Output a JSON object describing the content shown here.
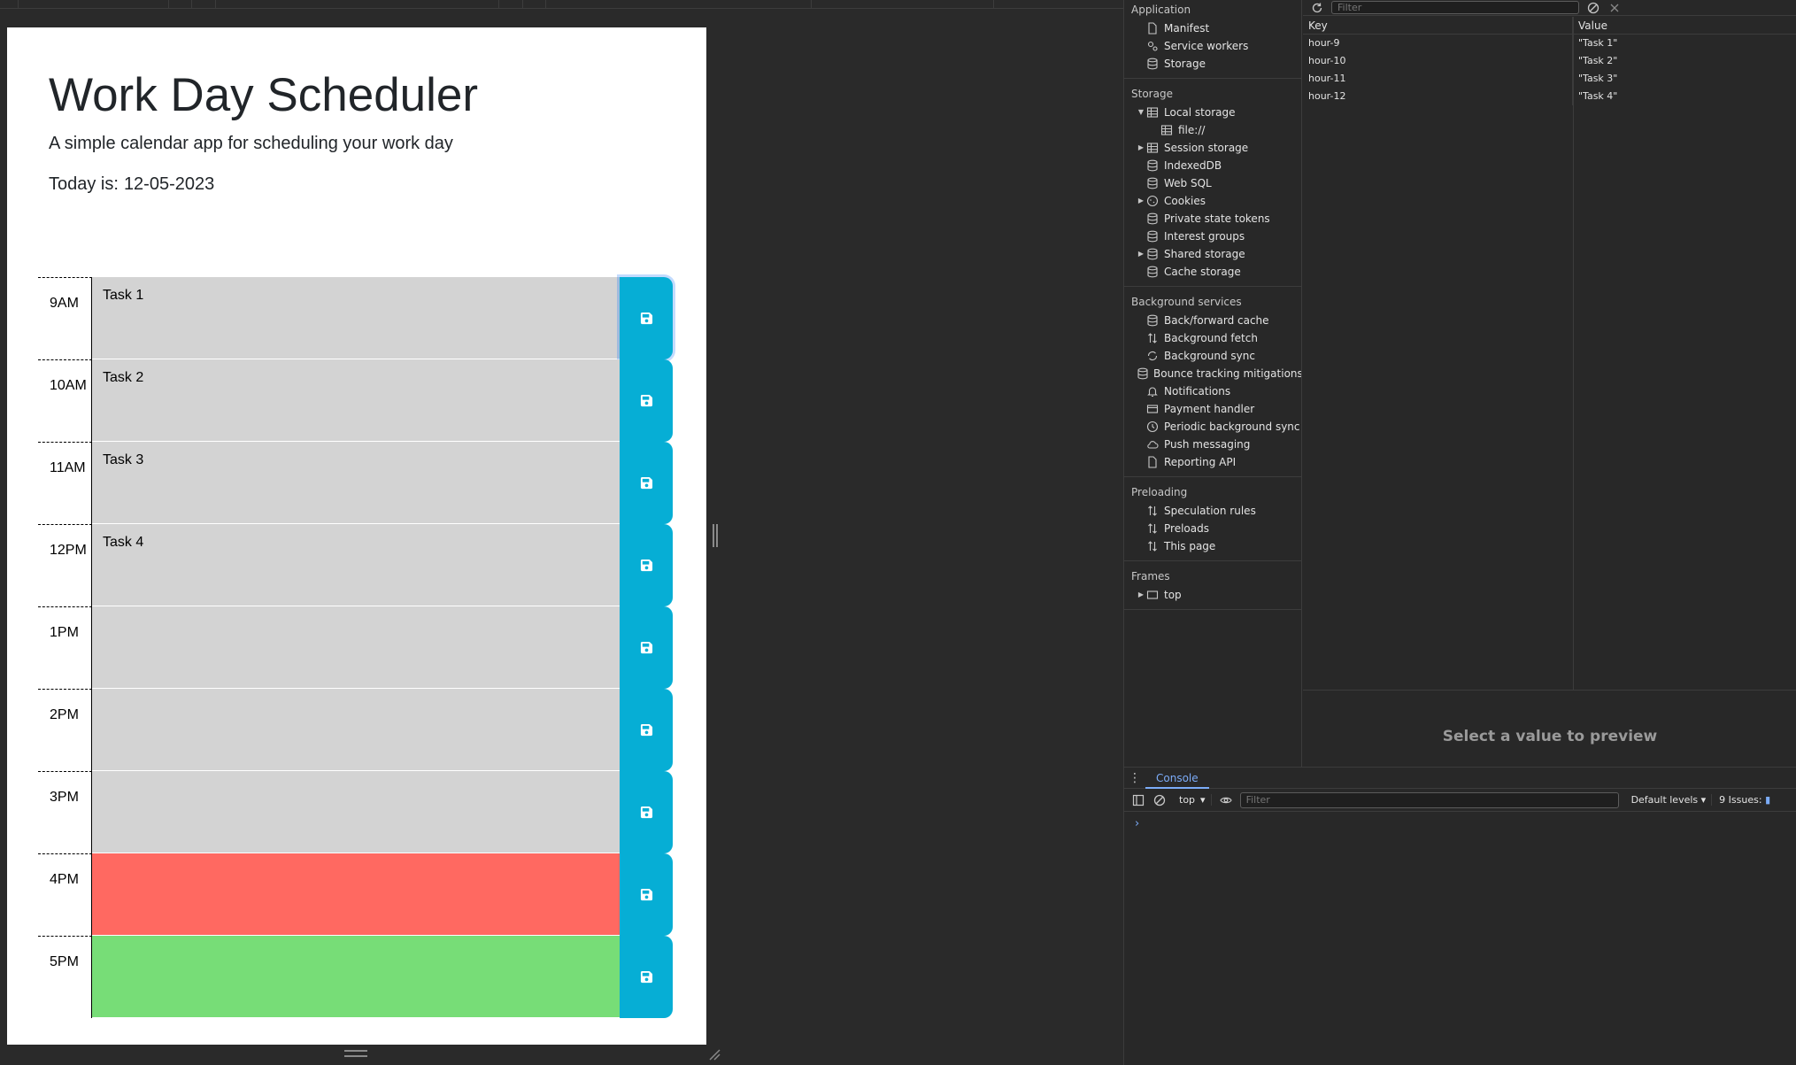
{
  "app": {
    "title": "Work Day Scheduler",
    "lead": "A simple calendar app for scheduling your work day",
    "today_label": "Today is:",
    "today_value": "12-05-2023"
  },
  "schedule": [
    {
      "hour": "9AM",
      "task": "Task 1",
      "state": "past"
    },
    {
      "hour": "10AM",
      "task": "Task 2",
      "state": "past"
    },
    {
      "hour": "11AM",
      "task": "Task 3",
      "state": "past"
    },
    {
      "hour": "12PM",
      "task": "Task 4",
      "state": "past"
    },
    {
      "hour": "1PM",
      "task": "",
      "state": "past"
    },
    {
      "hour": "2PM",
      "task": "",
      "state": "past"
    },
    {
      "hour": "3PM",
      "task": "",
      "state": "past"
    },
    {
      "hour": "4PM",
      "task": "",
      "state": "present"
    },
    {
      "hour": "5PM",
      "task": "",
      "state": "future"
    }
  ],
  "colors": {
    "past": "#d3d3d3",
    "present": "#ff6961",
    "future": "#77dd77",
    "save_button": "#06aed5",
    "devtools_bg": "#282828",
    "devtools_accent": "#7cacf8"
  },
  "devtools": {
    "sidebar": {
      "application": {
        "title": "Application",
        "items": [
          {
            "label": "Manifest",
            "icon": "file-icon"
          },
          {
            "label": "Service workers",
            "icon": "gears-icon"
          },
          {
            "label": "Storage",
            "icon": "database-icon"
          }
        ]
      },
      "storage": {
        "title": "Storage",
        "items": [
          {
            "label": "Local storage",
            "icon": "table-icon",
            "expanded": true
          },
          {
            "label": "file://",
            "icon": "table-icon",
            "child": true
          },
          {
            "label": "Session storage",
            "icon": "table-icon",
            "collapsed": true
          },
          {
            "label": "IndexedDB",
            "icon": "database-icon"
          },
          {
            "label": "Web SQL",
            "icon": "database-icon"
          },
          {
            "label": "Cookies",
            "icon": "cookie-icon",
            "collapsed": true
          },
          {
            "label": "Private state tokens",
            "icon": "database-icon"
          },
          {
            "label": "Interest groups",
            "icon": "database-icon"
          },
          {
            "label": "Shared storage",
            "icon": "database-icon",
            "collapsed": true
          },
          {
            "label": "Cache storage",
            "icon": "database-icon"
          }
        ]
      },
      "background": {
        "title": "Background services",
        "items": [
          {
            "label": "Back/forward cache",
            "icon": "database-icon"
          },
          {
            "label": "Background fetch",
            "icon": "arrows-updown-icon"
          },
          {
            "label": "Background sync",
            "icon": "sync-icon"
          },
          {
            "label": "Bounce tracking mitigations",
            "icon": "database-icon"
          },
          {
            "label": "Notifications",
            "icon": "bell-icon"
          },
          {
            "label": "Payment handler",
            "icon": "card-icon"
          },
          {
            "label": "Periodic background sync",
            "icon": "clock-icon"
          },
          {
            "label": "Push messaging",
            "icon": "cloud-icon"
          },
          {
            "label": "Reporting API",
            "icon": "file-icon"
          }
        ]
      },
      "preloading": {
        "title": "Preloading",
        "items": [
          {
            "label": "Speculation rules",
            "icon": "arrows-updown-icon"
          },
          {
            "label": "Preloads",
            "icon": "arrows-updown-icon"
          },
          {
            "label": "This page",
            "icon": "arrows-updown-icon"
          }
        ]
      },
      "frames": {
        "title": "Frames",
        "items": [
          {
            "label": "top",
            "icon": "frame-icon",
            "collapsed": true
          }
        ]
      }
    },
    "storage_table": {
      "filter_placeholder": "Filter",
      "columns": [
        "Key",
        "Value"
      ],
      "rows": [
        {
          "key": "hour-9",
          "value": "\"Task 1\""
        },
        {
          "key": "hour-10",
          "value": "\"Task 2\""
        },
        {
          "key": "hour-11",
          "value": "\"Task 3\""
        },
        {
          "key": "hour-12",
          "value": "\"Task 4\""
        }
      ],
      "preview_text": "Select a value to preview"
    },
    "console": {
      "tab": "Console",
      "context": "top",
      "filter_placeholder": "Filter",
      "levels": "Default levels",
      "issues": "9 Issues:",
      "prompt": "›"
    }
  }
}
